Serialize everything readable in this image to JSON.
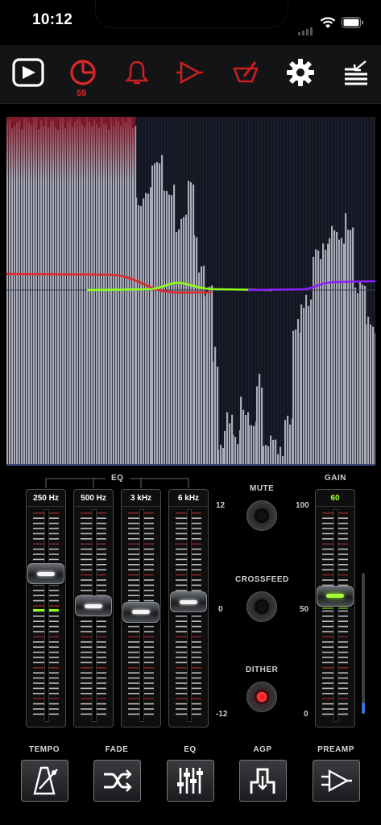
{
  "status": {
    "time": "10:12"
  },
  "toolbar": {
    "items": [
      {
        "name": "play-icon",
        "active": true
      },
      {
        "name": "timer-icon",
        "badge": "59"
      },
      {
        "name": "bell-icon"
      },
      {
        "name": "output-icon"
      },
      {
        "name": "effects-icon"
      },
      {
        "name": "gear-icon"
      },
      {
        "name": "queue-icon"
      }
    ],
    "timer_badge": "59"
  },
  "colors": {
    "red": "#e0282b",
    "green": "#8cff1a",
    "purple": "#8a20ff",
    "bars": "#a9acb8"
  },
  "spectrum": {
    "curve_colors": [
      "#e0282b",
      "#8cff1a",
      "#8a20ff"
    ]
  },
  "mixer": {
    "eq_label": "EQ",
    "eq_scale": {
      "top": "12",
      "mid": "0",
      "bottom": "-12"
    },
    "bands": [
      {
        "label": "250 Hz",
        "level": 0.71
      },
      {
        "label": "500 Hz",
        "level": 0.55
      },
      {
        "label": "3 kHz",
        "level": 0.52
      },
      {
        "label": "6 kHz",
        "level": 0.57
      }
    ],
    "mute_label": "MUTE",
    "crossfeed_label": "CROSSFEED",
    "dither_label": "DITHER",
    "dither_on": true,
    "gain_label": "GAIN",
    "gain_value": "60",
    "gain_scale": {
      "top": "100",
      "mid": "50",
      "bottom": "0"
    },
    "gain_level": 0.6
  },
  "bottom": {
    "items": [
      {
        "label": "TEMPO",
        "icon": "metronome-icon"
      },
      {
        "label": "FADE",
        "icon": "crossfade-icon"
      },
      {
        "label": "EQ",
        "icon": "equalizer-icon"
      },
      {
        "label": "AGP",
        "icon": "agp-icon"
      },
      {
        "label": "PREAMP",
        "icon": "preamp-icon"
      }
    ]
  }
}
